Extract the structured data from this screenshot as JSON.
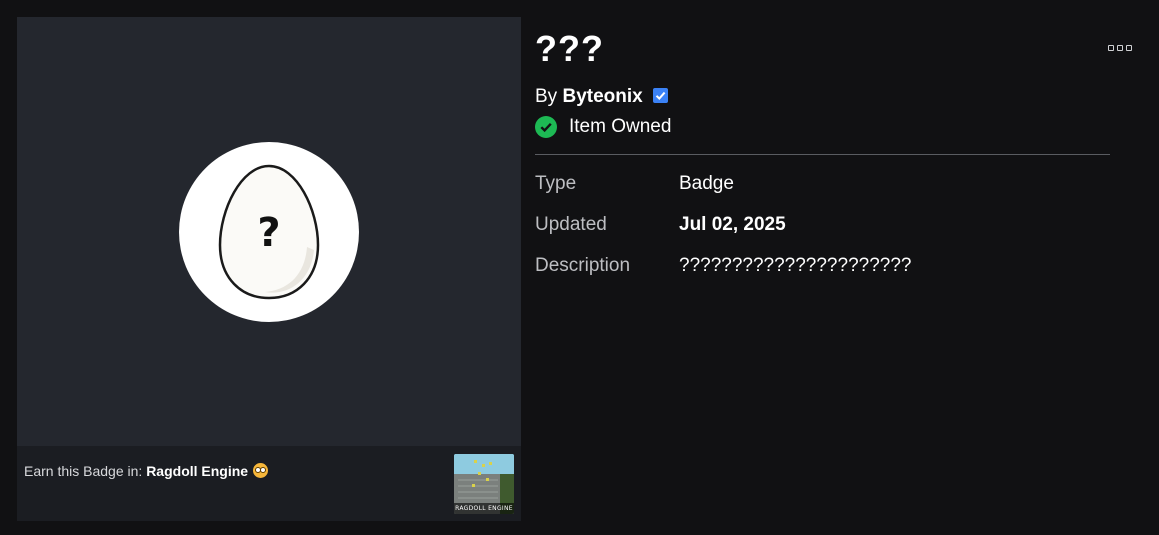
{
  "badge": {
    "title": "???",
    "creator_prefix": "By",
    "creator_name": "Byteonix",
    "owned_label": "Item Owned",
    "image_icon": "egg-question-icon"
  },
  "earn": {
    "prefix": "Earn this Badge in:",
    "game_name": "Ragdoll Engine",
    "game_thumb_label": "RAGDOLL ENGINE"
  },
  "details": {
    "type_label": "Type",
    "type_value": "Badge",
    "updated_label": "Updated",
    "updated_value": "Jul 02, 2025",
    "description_label": "Description",
    "description_value": "??????????????????????"
  },
  "icons": {
    "verified": "verified-badge-icon",
    "owned": "check-circle-icon",
    "more": "more-options-icon"
  },
  "colors": {
    "background": "#111113",
    "card": "#24272e",
    "owned_green": "#1db954",
    "verified_blue": "#3b82f6"
  }
}
